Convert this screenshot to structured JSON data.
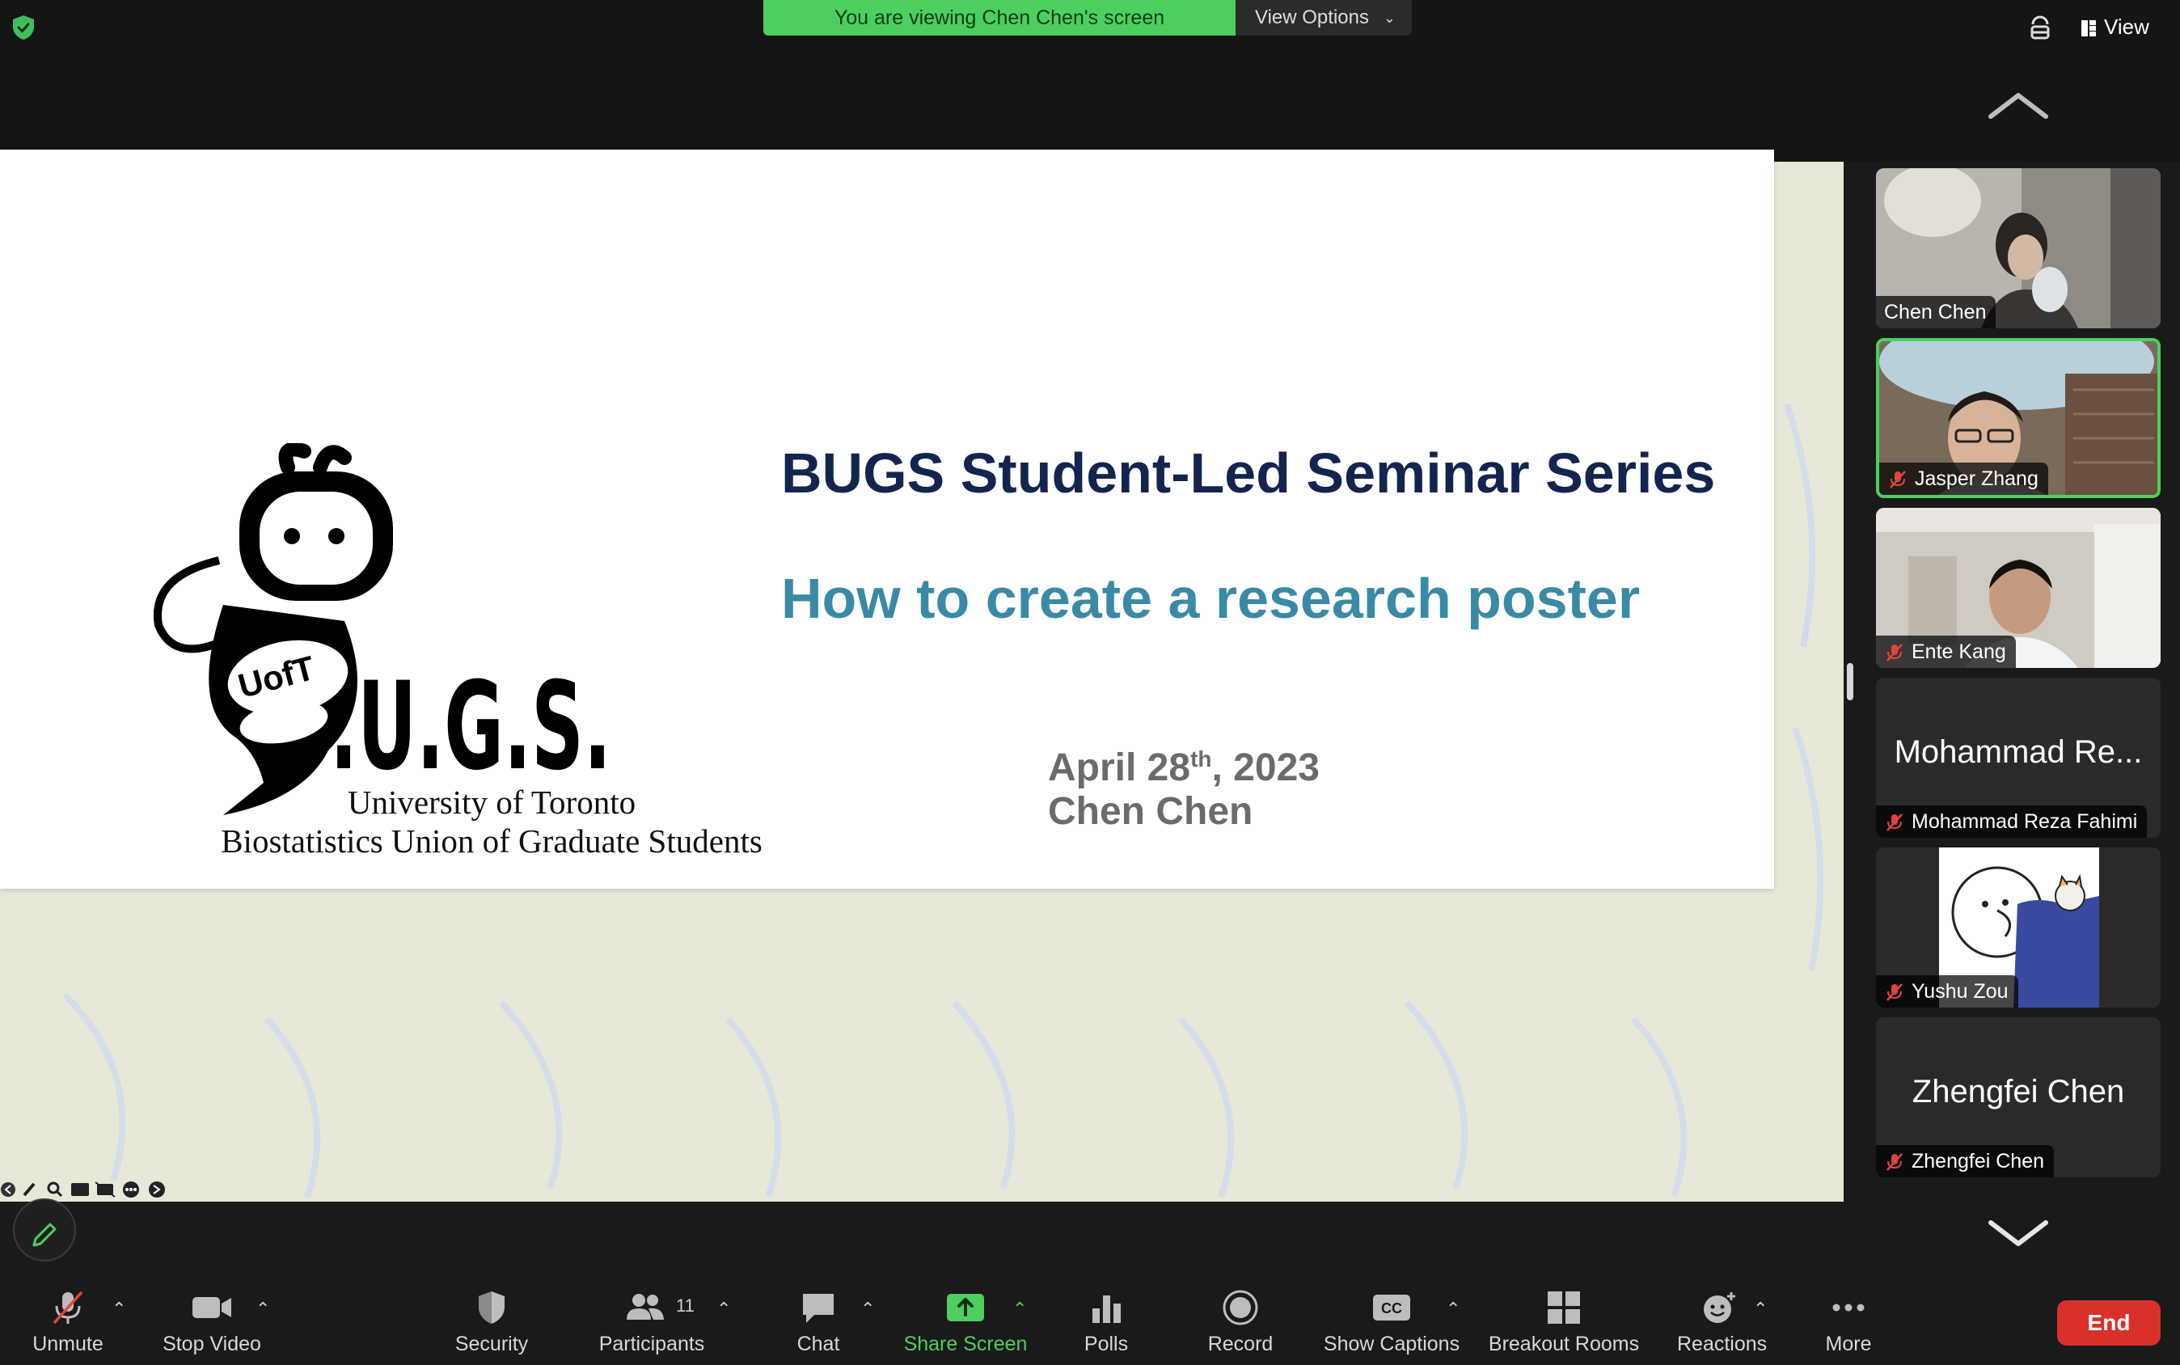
{
  "banner": {
    "viewing_text": "You are viewing Chen Chen's screen",
    "view_options_label": "View Options"
  },
  "topright": {
    "view_label": "View"
  },
  "slide": {
    "title": "BUGS Student-Led Seminar Series",
    "subtitle": "How to create a research poster",
    "date_main": "April 28",
    "date_sup": "th",
    "date_year": ", 2023",
    "presenter": "Chen Chen",
    "logo_text": ".U.G.S.",
    "logo_badge": "UofT",
    "university_line1": "University of Toronto",
    "university_line2": "Biostatistics Union of Graduate Students"
  },
  "participants": [
    {
      "name": "Chen Chen",
      "muted": false,
      "video": true,
      "active": false
    },
    {
      "name": "Jasper Zhang",
      "muted": true,
      "video": true,
      "active": true
    },
    {
      "name": "Ente Kang",
      "muted": true,
      "video": true,
      "active": false
    },
    {
      "name": "Mohammad Reza Fahimi",
      "display_name": "Mohammad Re...",
      "muted": true,
      "video": false,
      "active": false
    },
    {
      "name": "Yushu Zou",
      "muted": true,
      "video": true,
      "active": false
    },
    {
      "name": "Zhengfei Chen",
      "display_name": "Zhengfei Chen",
      "muted": true,
      "video": false,
      "active": false
    }
  ],
  "toolbar": {
    "unmute": "Unmute",
    "stop_video": "Stop Video",
    "security": "Security",
    "participants": "Participants",
    "participants_count": "11",
    "chat": "Chat",
    "share_screen": "Share Screen",
    "polls": "Polls",
    "record": "Record",
    "show_captions": "Show Captions",
    "breakout_rooms": "Breakout Rooms",
    "reactions": "Reactions",
    "more": "More",
    "end": "End"
  },
  "colors": {
    "share_green": "#4ccf5f",
    "end_red": "#d9302a",
    "slide_title": "#13254f",
    "slide_subtitle": "#3a8aa6"
  }
}
